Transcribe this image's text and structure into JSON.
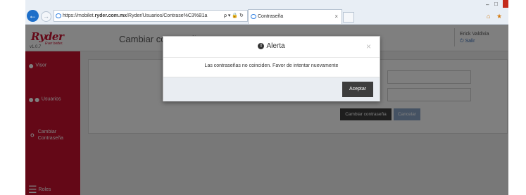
{
  "browser": {
    "address": "https://mobilet.ryder.com.mx/Ryder/Usuarios/Contrase%C3%B1a",
    "address_host": "ryder.com.mx",
    "address_tools": "ρ ▾ 🔒 ↻",
    "tab_title": "Contraseña"
  },
  "app": {
    "logo": "Ryder",
    "tagline": "Ever better.",
    "version": "v1.0.7",
    "page_title": "Cambiar contraseña",
    "user_name": "Erick Valdivia",
    "logout_label": "Salir"
  },
  "sidebar": {
    "items": [
      {
        "label": "Visor",
        "icon": "map-marker-icon"
      },
      {
        "label": "Usuarios",
        "icon": "users-icon"
      },
      {
        "label": "Cambiar Contraseña",
        "icon": "key-icon"
      },
      {
        "label": "Roles",
        "icon": "list-icon"
      }
    ]
  },
  "form": {
    "change_button": "Cambiar contraseña",
    "cancel_button": "Cancelar"
  },
  "modal": {
    "title": "Alerta",
    "message": "Las contraseñas no coinciden. Favor de intentar nuevamente",
    "accept_button": "Aceptar",
    "close_glyph": "×"
  },
  "colors": {
    "brand_red": "#c8102e",
    "overlay": "rgba(0,0,0,0.5)",
    "button_dark": "#3d3d3d"
  }
}
